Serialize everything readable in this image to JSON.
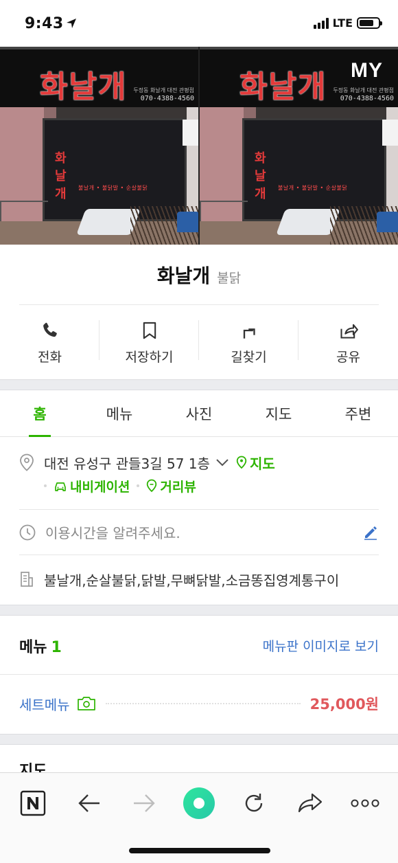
{
  "status_bar": {
    "time": "9:43",
    "network": "LTE",
    "battery_level": 0.75
  },
  "gallery": {
    "photo_sign_text": "화날개",
    "photo_door_text": "화날개",
    "photo_door_menu": "불날개 • 불닭발 • 순살불닭",
    "photo_phone": "070-4388-4560",
    "photo_small": "두정동 화날개 대전 관평점",
    "my_badge": "MY"
  },
  "place": {
    "name": "화날개",
    "category": "불닭"
  },
  "actions": [
    {
      "label": "전화",
      "icon": "phone-icon"
    },
    {
      "label": "저장하기",
      "icon": "bookmark-icon"
    },
    {
      "label": "길찾기",
      "icon": "directions-icon"
    },
    {
      "label": "공유",
      "icon": "share-icon"
    }
  ],
  "tabs": [
    {
      "label": "홈",
      "active": true
    },
    {
      "label": "메뉴",
      "active": false
    },
    {
      "label": "사진",
      "active": false
    },
    {
      "label": "지도",
      "active": false
    },
    {
      "label": "주변",
      "active": false
    }
  ],
  "info": {
    "address": "대전 유성구 관들3길 57 1층",
    "map_link": "지도",
    "navigation_link": "내비게이션",
    "streetview_link": "거리뷰",
    "hours_placeholder": "이용시간을 알려주세요.",
    "description": "불날개,순살불닭,닭발,무뼈닭발,소금똥집영계통구이"
  },
  "menu": {
    "title": "메뉴",
    "count": "1",
    "view_image_link": "메뉴판 이미지로 보기",
    "items": [
      {
        "name": "세트메뉴",
        "price": "25,000원"
      }
    ]
  },
  "next_section_title": "지도",
  "colors": {
    "accent_green": "#2db400",
    "link_blue": "#3a72c9",
    "price_red": "#e0585c"
  }
}
